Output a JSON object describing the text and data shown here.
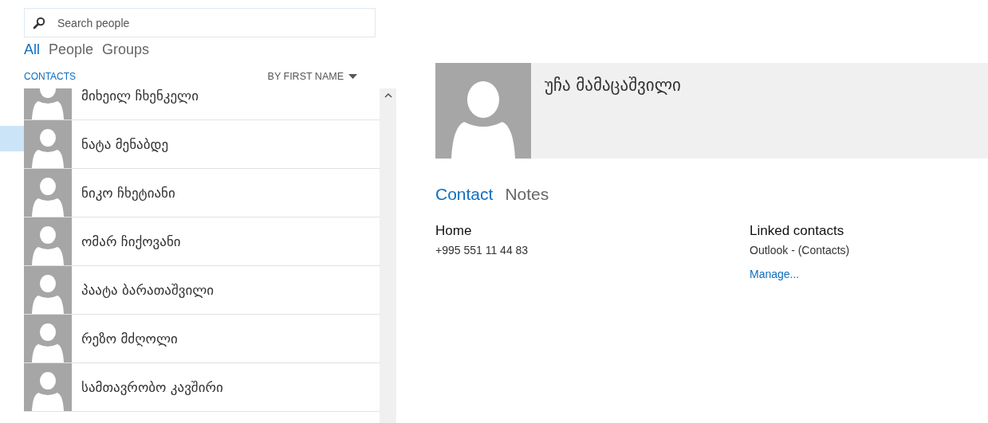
{
  "search": {
    "placeholder": "Search people"
  },
  "filters": [
    {
      "label": "All",
      "selected": true
    },
    {
      "label": "People",
      "selected": false
    },
    {
      "label": "Groups",
      "selected": false
    }
  ],
  "list_header": {
    "title": "CONTACTS",
    "sort": "BY FIRST NAME"
  },
  "contacts": [
    {
      "name": "მიხეილ ჩხენკელი"
    },
    {
      "name": "ნატა მენაბდე"
    },
    {
      "name": "ნიკო ჩხეტიანი"
    },
    {
      "name": "ომარ ჩიქოვანი"
    },
    {
      "name": "პაატა ბარათაშვილი"
    },
    {
      "name": "რეზო მძღოლი"
    },
    {
      "name": "სამთავრობო კავშირი"
    }
  ],
  "details": {
    "name": "უჩა მამაცაშვილი",
    "tabs": [
      {
        "label": "Contact",
        "selected": true
      },
      {
        "label": "Notes",
        "selected": false
      }
    ],
    "home": {
      "label": "Home",
      "phone": "+995 551 11 44 83"
    },
    "linked": {
      "label": "Linked contacts",
      "source": "Outlook - (Contacts)",
      "link": "Manage..."
    }
  }
}
